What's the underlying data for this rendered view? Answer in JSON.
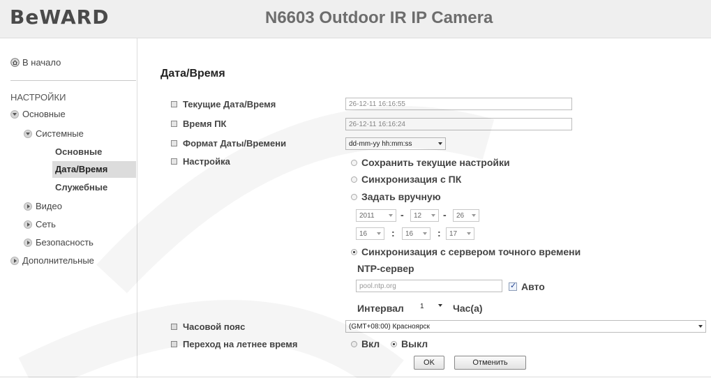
{
  "header": {
    "logo": "BeWARD",
    "title": "N6603 Outdoor IR IP Camera"
  },
  "sidebar": {
    "home": "В начало",
    "section": "НАСТРОЙКИ",
    "items": [
      {
        "label": "Основные"
      },
      {
        "label": "Системные"
      },
      {
        "label": "Основные"
      },
      {
        "label": "Дата/Время"
      },
      {
        "label": "Служебные"
      },
      {
        "label": "Видео"
      },
      {
        "label": "Сеть"
      },
      {
        "label": "Безопасность"
      },
      {
        "label": "Дополнительные"
      }
    ]
  },
  "main": {
    "title": "Дата/Время",
    "labels": {
      "current": "Текущие Дата/Время",
      "pc_time": "Время ПК",
      "format": "Формат Даты/Времени",
      "setup": "Настройка",
      "timezone": "Часовой пояс",
      "dst": "Переход на летнее время"
    },
    "current_value": "26-12-11  16:16:55",
    "pc_value": "26-12-11  16:16:24",
    "format_value": "dd-mm-yy hh:mm:ss",
    "options": {
      "keep": "Сохранить текущие настройки",
      "sync_pc": "Синхронизация с ПК",
      "manual": "Задать вручную",
      "ntp": "Синхронизация с сервером точного времени"
    },
    "manual": {
      "year": "2011",
      "month": "12",
      "day": "26",
      "hour": "16",
      "minute": "16",
      "second": "17",
      "date_sep": "-",
      "time_sep": ":"
    },
    "ntp": {
      "label": "NTP-сервер",
      "server": "pool.ntp.org",
      "auto": "Авто",
      "interval_label": "Интервал",
      "interval_value": "1",
      "unit": "Час(а)"
    },
    "timezone_value": "(GMT+08:00) Красноярск",
    "dst": {
      "on": "Вкл",
      "off": "Выкл"
    },
    "buttons": {
      "ok": "OK",
      "cancel": "Отменить"
    }
  }
}
